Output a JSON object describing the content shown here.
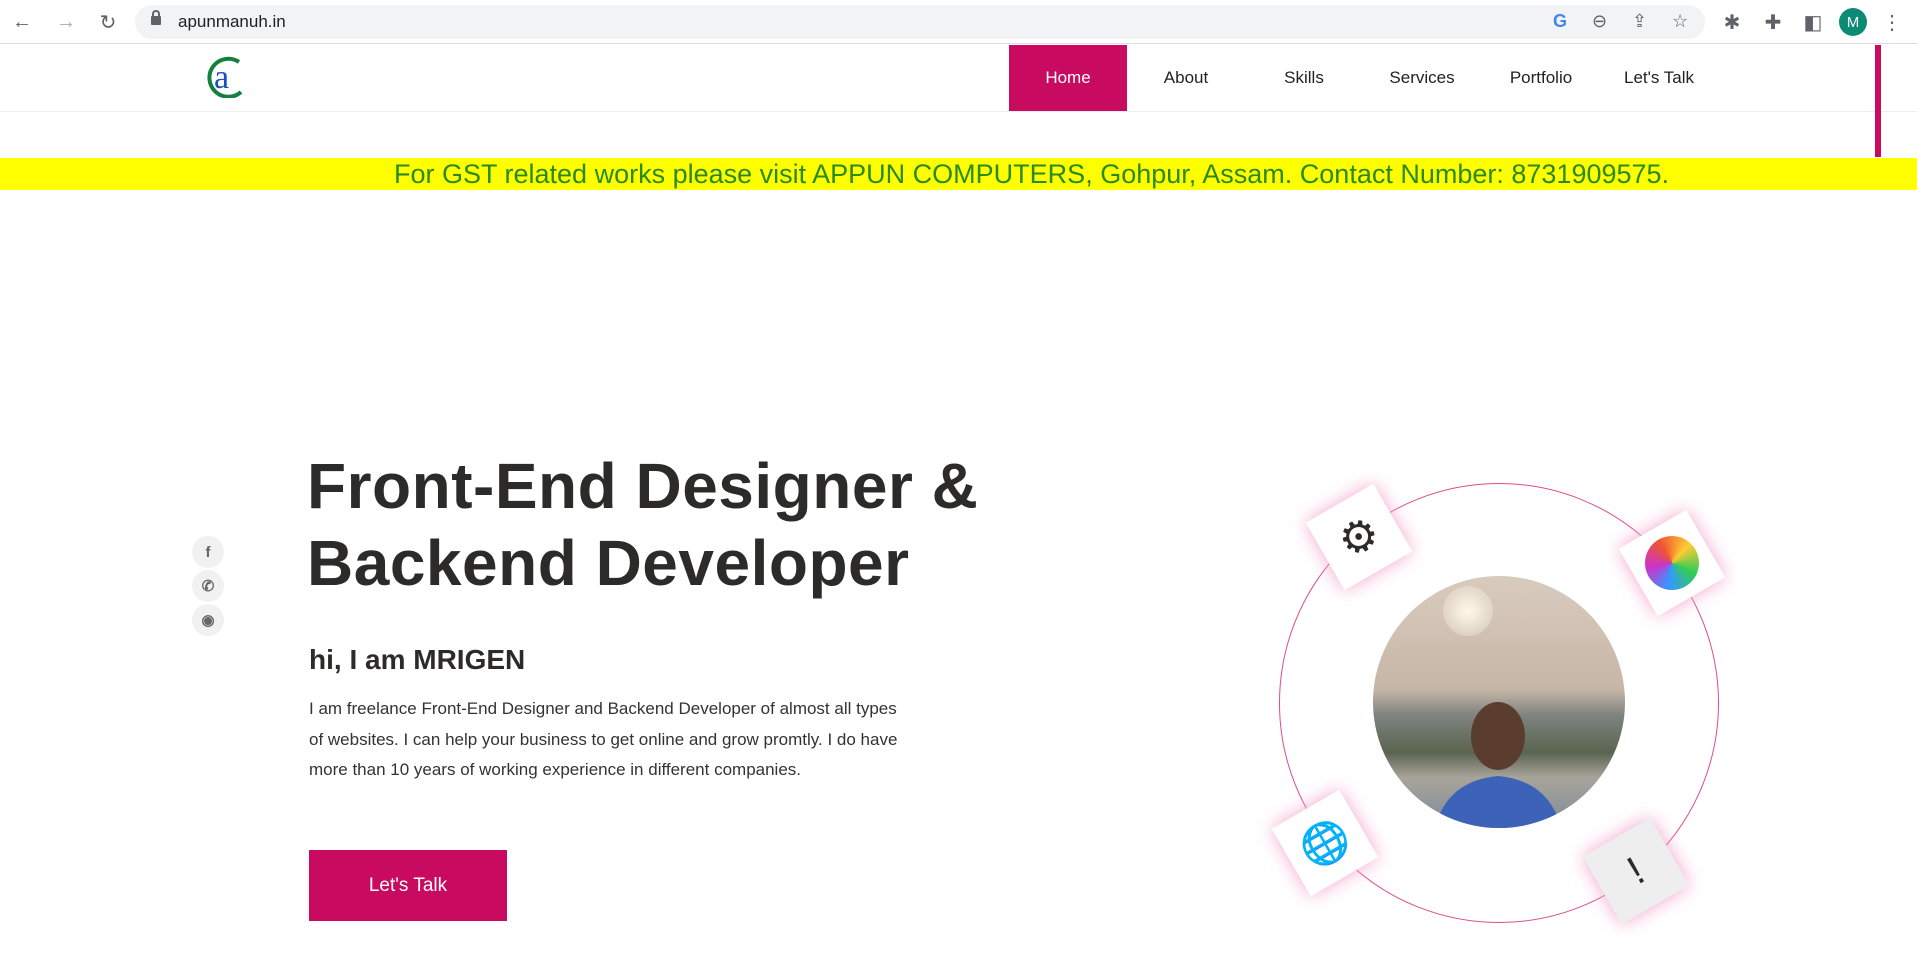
{
  "browser": {
    "url": "apunmanuh.in",
    "profile_initial": "M"
  },
  "nav": {
    "logo_text": "a",
    "items": [
      {
        "label": "Home",
        "active": true
      },
      {
        "label": "About"
      },
      {
        "label": "Skills"
      },
      {
        "label": "Services"
      },
      {
        "label": "Portfolio"
      },
      {
        "label": "Let's Talk"
      }
    ]
  },
  "banner": {
    "text": "For GST related works please visit APPUN COMPUTERS, Gohpur, Assam. Contact Number: 8731909575."
  },
  "hero": {
    "title_line1": "Front-End Designer &",
    "title_line2": "Backend Developer",
    "greeting": "hi, I am MRIGEN",
    "description": "I am freelance Front-End Designer and Backend Developer of almost all types of websites. I can help your business to get online and grow promtly. I do have more than 10 years of working experience in different companies.",
    "cta_label": "Let's Talk"
  },
  "social": [
    {
      "icon": "facebook-icon",
      "glyph": "f"
    },
    {
      "icon": "whatsapp-icon",
      "glyph": "✆"
    },
    {
      "icon": "github-icon",
      "glyph": "◉"
    }
  ],
  "colors": {
    "accent": "#c80a60",
    "banner_bg": "#ffff00",
    "banner_text": "#2b8a1c"
  }
}
